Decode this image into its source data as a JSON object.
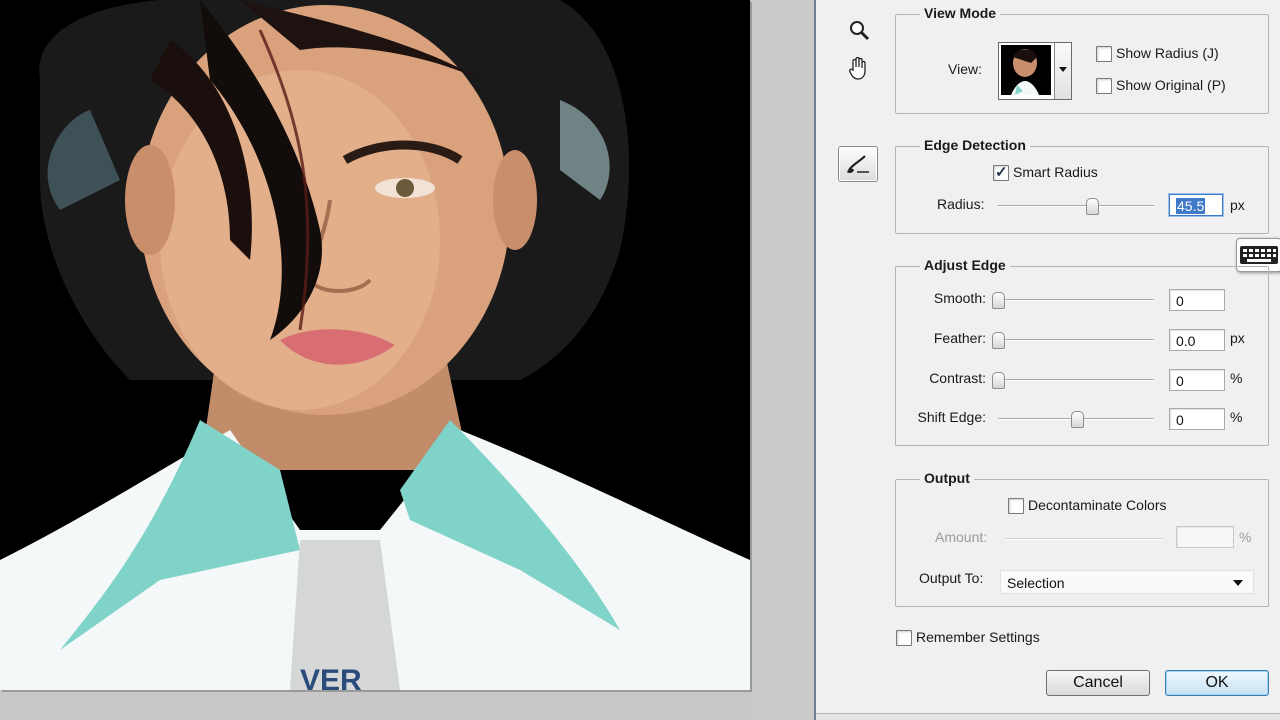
{
  "view_mode": {
    "title": "View Mode",
    "view_label": "View:",
    "show_radius_label": "Show Radius (J)",
    "show_radius_checked": false,
    "show_original_label": "Show Original (P)",
    "show_original_checked": false
  },
  "edge_detection": {
    "title": "Edge Detection",
    "smart_radius_label": "Smart Radius",
    "smart_radius_checked": true,
    "radius_label": "Radius:",
    "radius_value": "45.5",
    "radius_unit": "px",
    "radius_slider_fraction": 0.61
  },
  "adjust_edge": {
    "title": "Adjust Edge",
    "rows": [
      {
        "label": "Smooth:",
        "value": "0",
        "unit": "",
        "fraction": 0.0
      },
      {
        "label": "Feather:",
        "value": "0.0",
        "unit": "px",
        "fraction": 0.0
      },
      {
        "label": "Contrast:",
        "value": "0",
        "unit": "%",
        "fraction": 0.0
      },
      {
        "label": "Shift Edge:",
        "value": "0",
        "unit": "%",
        "fraction": 0.5
      }
    ]
  },
  "output": {
    "title": "Output",
    "decontaminate_label": "Decontaminate Colors",
    "decontaminate_checked": false,
    "amount_label": "Amount:",
    "amount_value": "",
    "amount_unit": "%",
    "output_to_label": "Output To:",
    "output_to_value": "Selection"
  },
  "remember_settings_label": "Remember Settings",
  "remember_settings_checked": false,
  "buttons": {
    "cancel": "Cancel",
    "ok": "OK"
  },
  "tools": [
    "zoom-icon",
    "hand-icon",
    "refine-radius-brush-icon"
  ],
  "colors": {
    "selection_blue": "#3f79c7",
    "shirt_teal": "#7fd3c8",
    "dialog_bg": "#f0f0f0"
  }
}
